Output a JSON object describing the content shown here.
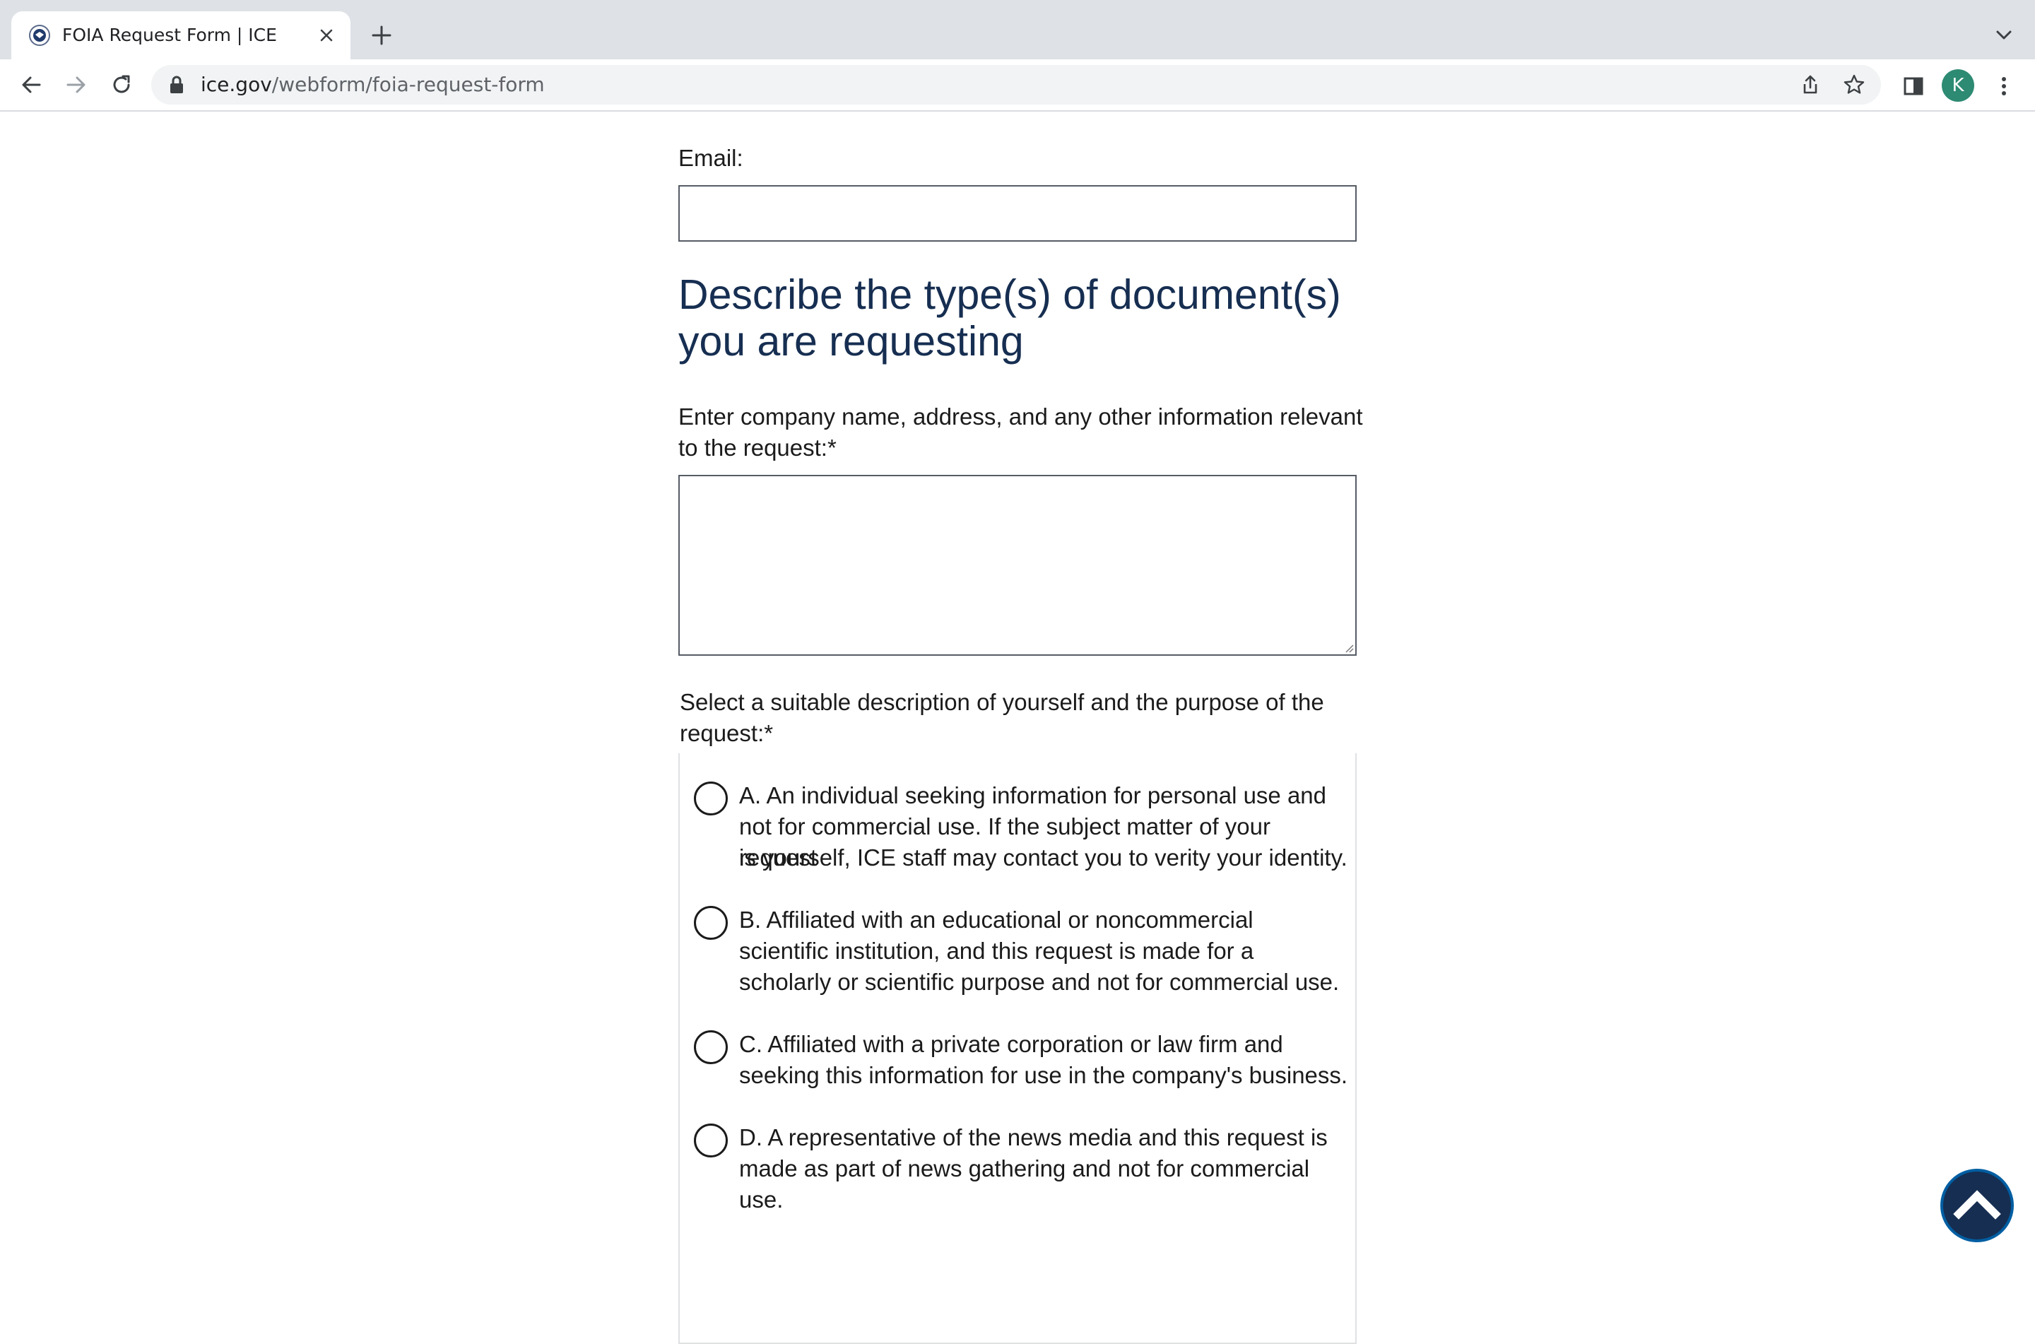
{
  "browser": {
    "tab_title": "FOIA Request Form | ICE",
    "url_host": "ice.gov",
    "url_path": "/webform/foia-request-form",
    "profile_initial": "K"
  },
  "form": {
    "email_label": "Email:",
    "section_heading": "Describe the type(s) of document(s) you are requesting",
    "company_label_line1": "Enter company name, address, and any other information relevant",
    "company_label_line2": "to the request:*",
    "purpose_label_line1": "Select a suitable description of yourself and the purpose of the",
    "purpose_label_line2": "request:*",
    "options": [
      {
        "line1": "A. An individual seeking information for personal use and",
        "line2": "not for commercial use. If the subject matter of your request",
        "line3": "is yourself, ICE staff may contact you to verity your identity."
      },
      {
        "line1": "B. Affiliated with an educational or noncommercial",
        "line2": "scientific institution, and this request is made for a",
        "line3": "scholarly or scientific purpose and not for commercial use."
      },
      {
        "line1": "C. Affiliated with a private corporation or law firm and",
        "line2": "seeking this information for use in the company's business."
      },
      {
        "line1": "D. A representative of the news media and this request is",
        "line2": "made as part of news gathering and not for commercial use."
      }
    ]
  },
  "colors": {
    "heading": "#162e51",
    "back_to_top": "#162e51",
    "avatar": "#2d8a73"
  },
  "icons": [
    "seal-favicon-icon",
    "close-icon",
    "plus-icon",
    "chevron-down-icon",
    "back-arrow-icon",
    "forward-arrow-icon",
    "reload-icon",
    "lock-icon",
    "share-icon",
    "star-icon",
    "side-panel-icon",
    "kebab-menu-icon",
    "chevron-up-icon"
  ]
}
